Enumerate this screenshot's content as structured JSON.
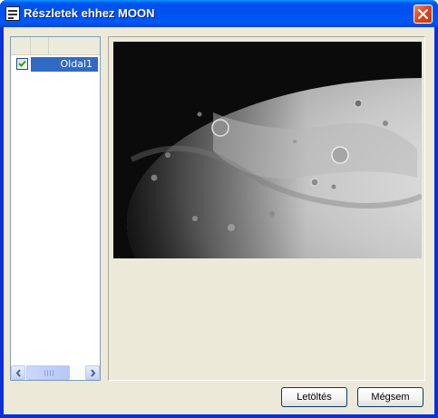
{
  "window": {
    "title": "Részletek ehhez MOON",
    "title_icon": "window-app-icon",
    "close_icon": "close-icon",
    "colors": {
      "titlebar": "#0053ee",
      "client_bg": "#ece9d8",
      "selection": "#316ac5",
      "close": "#d9461e"
    }
  },
  "pages_list": {
    "items": [
      {
        "label": "Oldal1",
        "checked": true,
        "selected": true
      }
    ],
    "scrollbar": {
      "left_icon": "chevron-left-icon",
      "right_icon": "chevron-right-icon"
    }
  },
  "preview": {
    "image": "moon-photo"
  },
  "buttons": {
    "download_label": "Letöltés",
    "cancel_label": "Mégsem"
  }
}
